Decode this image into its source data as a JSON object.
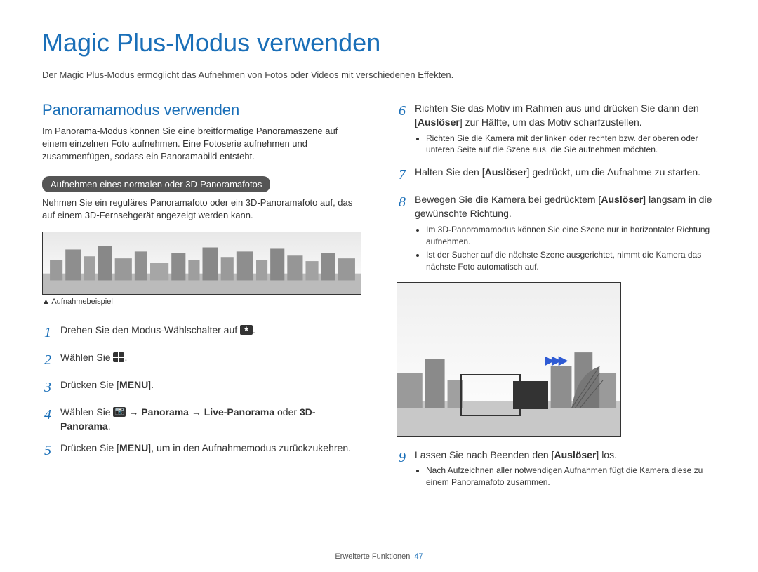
{
  "title": "Magic Plus-Modus verwenden",
  "intro": "Der Magic Plus-Modus ermöglicht das Aufnehmen von Fotos oder Videos mit verschiedenen Effekten.",
  "section": {
    "heading": "Panoramamodus verwenden",
    "intro": "Im Panorama-Modus können Sie eine breitformatige Panoramaszene auf einem einzelnen Foto aufnehmen. Eine Fotoserie aufnehmen und zusammenfügen, sodass ein Panoramabild entsteht.",
    "pill": "Aufnehmen eines normalen oder 3D-Panoramafotos",
    "pill_desc": "Nehmen Sie ein reguläres Panoramafoto oder ein 3D-Panoramafoto auf, das auf einem 3D-Fernsehgerät angezeigt werden kann.",
    "caption_marker": "▲",
    "caption": "Aufnahmebeispiel"
  },
  "steps_left": [
    {
      "n": "1",
      "pre": "Drehen Sie den Modus-Wählschalter auf ",
      "icon": "star",
      "post": "."
    },
    {
      "n": "2",
      "pre": "Wählen Sie ",
      "icon": "grid",
      "post": "."
    },
    {
      "n": "3",
      "pre": "Drücken Sie [",
      "menu": "MENU",
      "post": "]."
    },
    {
      "n": "4",
      "pre": "Wählen Sie ",
      "icon": "cam",
      "arrow1": " → ",
      "b1": "Panorama",
      "arrow2": " → ",
      "b2": "Live-Panorama",
      "or": " oder ",
      "b3": "3D-Panorama",
      "post2": "."
    },
    {
      "n": "5",
      "pre": "Drücken Sie [",
      "menu": "MENU",
      "post": "], um in den Aufnahmemodus zurückzukehren."
    }
  ],
  "steps_right": [
    {
      "n": "6",
      "line_pre": "Richten Sie das Motiv im Rahmen aus und drücken Sie dann den [",
      "bold": "Auslöser",
      "line_post": "] zur Hälfte, um das Motiv scharfzustellen.",
      "bullets": [
        "Richten Sie die Kamera mit der linken oder rechten bzw. der oberen oder unteren Seite auf die Szene aus, die Sie aufnehmen möchten."
      ]
    },
    {
      "n": "7",
      "line_pre": "Halten Sie den [",
      "bold": "Auslöser",
      "line_post": "] gedrückt, um die Aufnahme zu starten."
    },
    {
      "n": "8",
      "line_pre": "Bewegen Sie die Kamera bei gedrücktem [",
      "bold": "Auslöser",
      "line_post": "] langsam in die gewünschte Richtung.",
      "bullets": [
        "Im 3D-Panoramamodus können Sie eine Szene nur in horizontaler Richtung aufnehmen.",
        "Ist der Sucher auf die nächste Szene ausgerichtet, nimmt die Kamera das nächste Foto automatisch auf."
      ]
    },
    {
      "n": "9",
      "line_pre": "Lassen Sie nach Beenden den [",
      "bold": "Auslöser",
      "line_post": "] los.",
      "bullets": [
        "Nach Aufzeichnen aller notwendigen Aufnahmen fügt die Kamera diese zu einem Panoramafoto zusammen."
      ]
    }
  ],
  "footer": {
    "section": "Erweiterte Funktionen",
    "page": "47"
  }
}
